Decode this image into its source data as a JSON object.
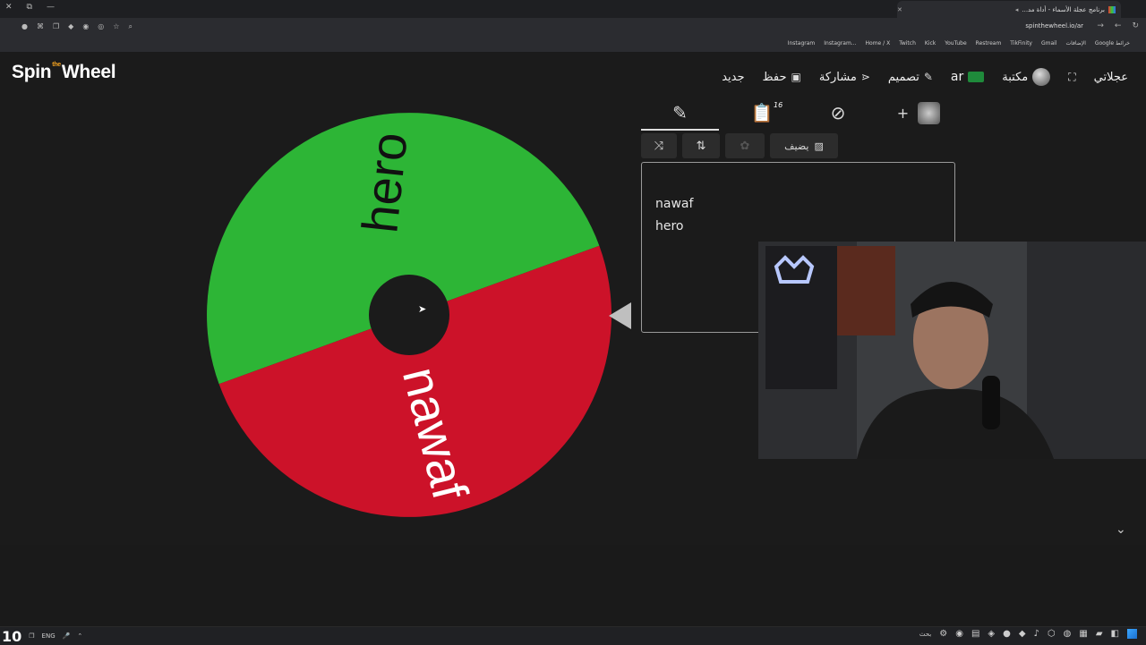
{
  "browser": {
    "tab_title": "برنامج عجلة الأسماء - أداة مد...",
    "new_tab": "+",
    "url": "spinthewheel.io/ar",
    "bookmarks": [
      "Instagram",
      "Instagram...",
      "Home / X",
      "Twitch",
      "Kick",
      "YouTube",
      "Restream",
      "TikFinity",
      "Gmail",
      "الإضافات",
      "Google خرائط"
    ]
  },
  "app": {
    "logo_left": "Spin",
    "logo_the": "the",
    "logo_right": "Wheel",
    "nav": {
      "wheels": "عجلاتي",
      "library": "مكتبة",
      "lang": "ar",
      "design": "تصميم",
      "share": "مشاركة",
      "save": "حفظ",
      "new": "جديد"
    }
  },
  "wheel": {
    "segments": [
      {
        "label": "hero",
        "color": "#2db536"
      },
      {
        "label": "nawaf",
        "color": "#cc1229"
      }
    ],
    "hub_color": "#1b1b1b"
  },
  "panel": {
    "entries_count": "16",
    "add_image_label": "يضيف",
    "entries": [
      "nawaf",
      "hero"
    ]
  },
  "taskbar": {
    "clock": "10",
    "lang": "ENG",
    "search": "بحث"
  }
}
